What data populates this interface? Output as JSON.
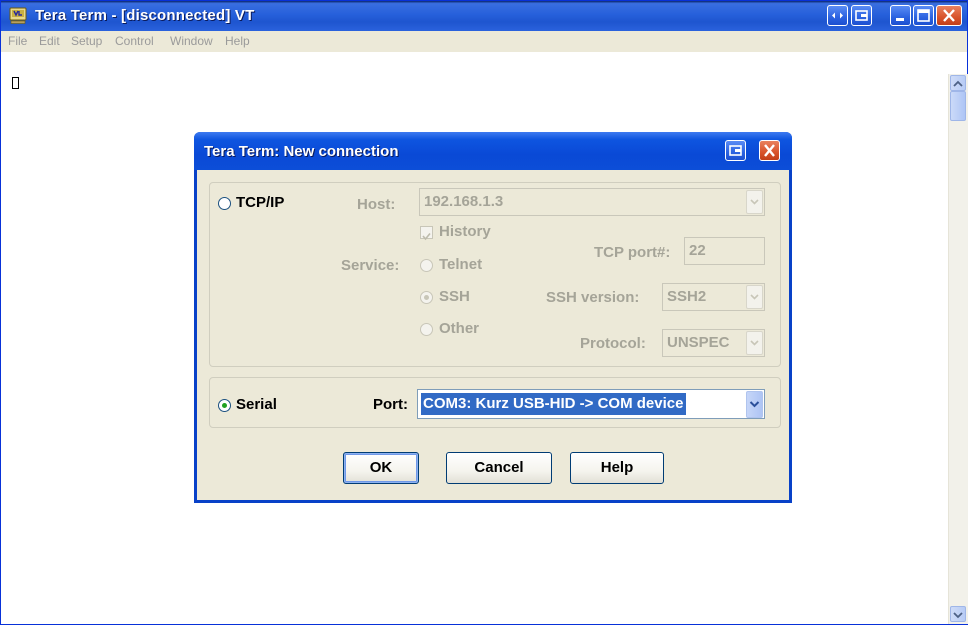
{
  "window": {
    "title": "Tera Term - [disconnected] VT",
    "menu": [
      "File",
      "Edit",
      "Setup",
      "Control",
      "Window",
      "Help"
    ]
  },
  "dialog": {
    "title": "Tera Term: New connection",
    "tcpip": {
      "radio_label": "TCP/IP",
      "host_label": "Host:",
      "host_value": "192.168.1.3",
      "history_label": "History",
      "service_label": "Service:",
      "services": [
        "Telnet",
        "SSH",
        "Other"
      ],
      "selected_service": "SSH",
      "tcp_port_label": "TCP port#:",
      "tcp_port_value": "22",
      "ssh_version_label": "SSH version:",
      "ssh_version_value": "SSH2",
      "protocol_label": "Protocol:",
      "protocol_value": "UNSPEC"
    },
    "serial": {
      "radio_label": "Serial",
      "port_label": "Port:",
      "port_value": "COM3: Kurz USB-HID -> COM device"
    },
    "buttons": {
      "ok": "OK",
      "cancel": "Cancel",
      "help": "Help"
    }
  },
  "icons": {
    "app": "tera-term-icon",
    "close": "close-icon",
    "minimize": "minimize-icon",
    "maximize": "maximize-icon",
    "restore": "restore-icon"
  },
  "colors": {
    "titlebar": "#2660db",
    "dialog_body": "#ece9d8",
    "selection": "#316ac5",
    "disabled_text": "#a5a498"
  }
}
